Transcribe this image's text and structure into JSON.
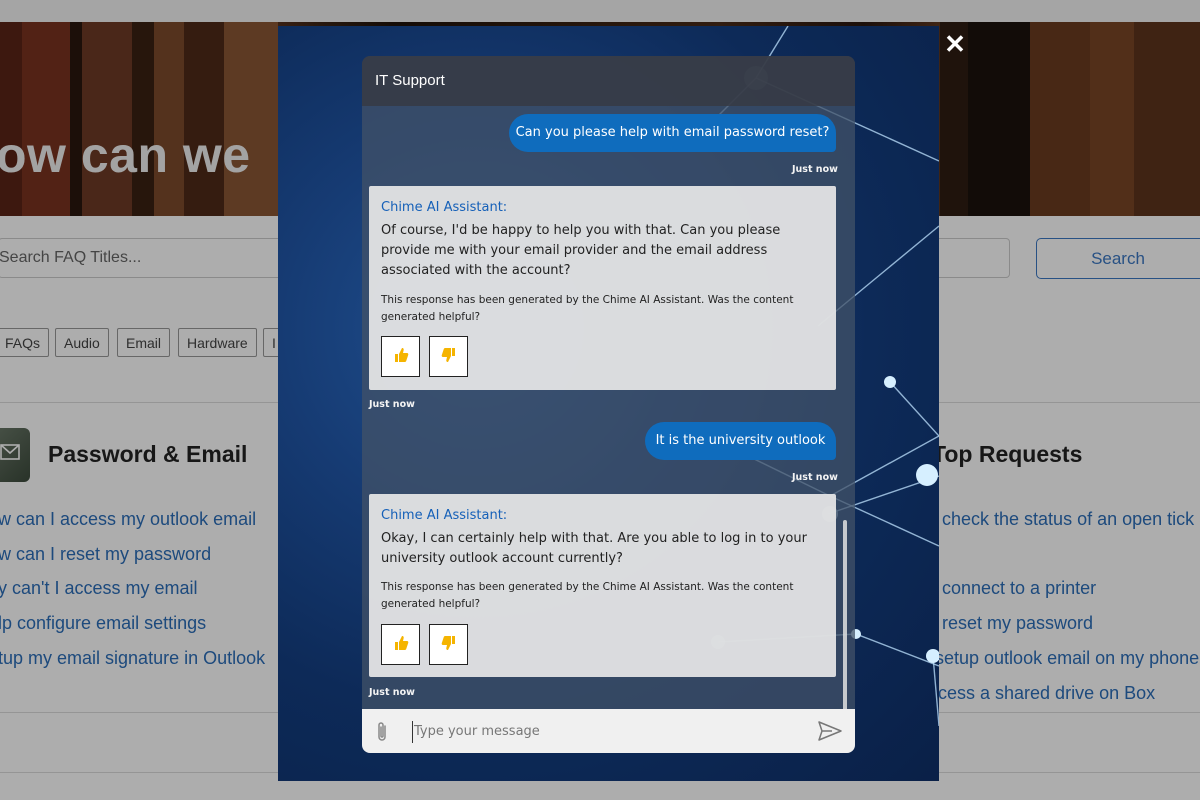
{
  "background": {
    "hero_title": "ow can we",
    "search": {
      "placeholder": "Search FAQ Titles...",
      "button_label": "Search"
    },
    "tags": [
      "FAQs",
      "Audio",
      "Email",
      "Hardware",
      "I"
    ],
    "password_email": {
      "title": "Password & Email",
      "links": [
        "w can I access my outlook email",
        "w can I reset my password",
        "y can't I access my email",
        "lp configure email settings",
        "tup my email signature in Outlook"
      ]
    },
    "top_requests": {
      "title": "Top Requests",
      "links": [
        "check the status of an open tick",
        "connect to a printer",
        "reset my password",
        "setup outlook email on my phone",
        "cess a shared drive on Box"
      ]
    }
  },
  "chat": {
    "title": "IT Support",
    "close_label": "✕",
    "messages": [
      {
        "role": "user",
        "text": "Can you please help with email password reset?",
        "time": "Just now"
      },
      {
        "role": "bot",
        "sender": "Chime AI Assistant:",
        "text": "Of course, I'd be happy to help you with that. Can you please provide me with your email provider and the email address associated with the account?",
        "disclaimer": "This response has been generated by the Chime AI Assistant. Was the content generated helpful?",
        "time": "Just now"
      },
      {
        "role": "user",
        "text": "It is the university outlook",
        "time": "Just now"
      },
      {
        "role": "bot",
        "sender": "Chime AI Assistant:",
        "text": "Okay, I can certainly help with that. Are you able to log in to your university outlook account currently?",
        "disclaimer": "This response has been generated by the Chime AI Assistant. Was the content generated helpful?",
        "time": "Just now"
      }
    ],
    "composer": {
      "placeholder": "Type your message"
    },
    "icons": {
      "attach": "paperclip-icon",
      "send": "send-icon",
      "thumbs_up": "thumbs-up-icon",
      "thumbs_down": "thumbs-down-icon",
      "close": "close-icon"
    },
    "colors": {
      "user_bubble": "#0f6cbd",
      "bot_sender": "#1560b8",
      "thumb": "#f5b400"
    }
  }
}
